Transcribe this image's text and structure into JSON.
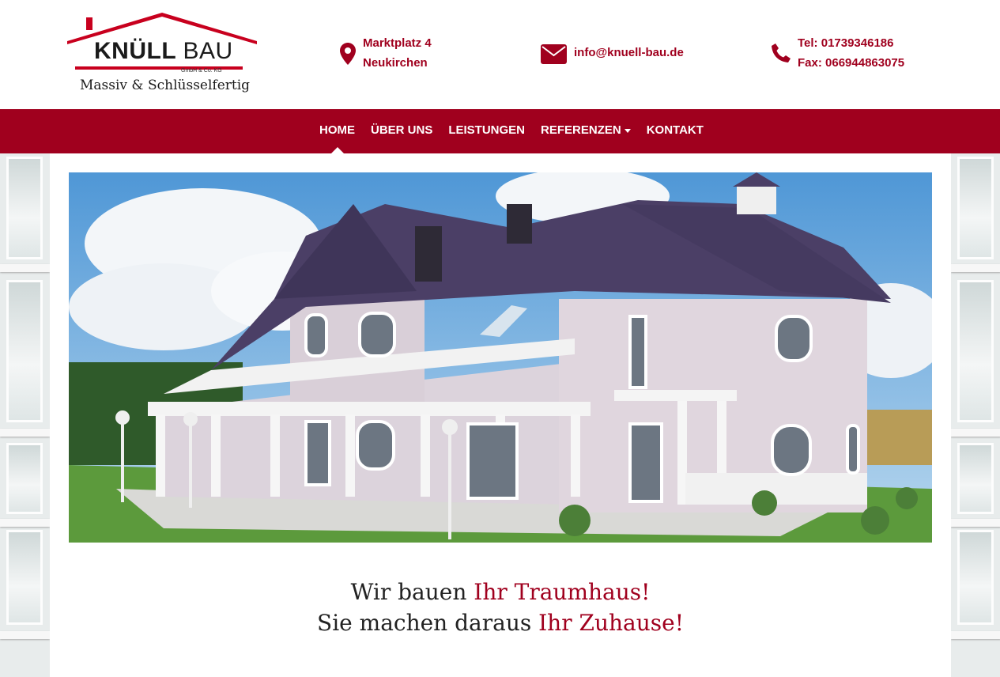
{
  "brand": {
    "name_bold": "KNÜLL",
    "name_light": "BAU",
    "legal_form": "GmbH & Co. KG",
    "tagline": "Massiv & Schlüsselfertig",
    "accent_color": "#a0001e"
  },
  "contact": {
    "address": {
      "icon": "map-marker-icon",
      "line1": "Marktplatz 4",
      "line2": "Neukirchen"
    },
    "email": {
      "icon": "envelope-icon",
      "value": "info@knuell-bau.de"
    },
    "phone": {
      "icon": "phone-icon",
      "tel": "Tel: 01739346186",
      "fax": "Fax: 066944863075"
    }
  },
  "nav": {
    "items": [
      {
        "label": "HOME",
        "active": true
      },
      {
        "label": "ÜBER UNS"
      },
      {
        "label": "LEISTUNGEN"
      },
      {
        "label": "REFERENZEN",
        "dropdown": true
      },
      {
        "label": "KONTAKT"
      }
    ]
  },
  "hero": {
    "image": "white-villa-with-dark-tiled-roof"
  },
  "slogan": {
    "line1_plain": "Wir bauen ",
    "line1_accent": "Ihr Traumhaus!",
    "line2_plain": "Sie machen daraus ",
    "line2_accent": "Ihr Zuhause!"
  }
}
